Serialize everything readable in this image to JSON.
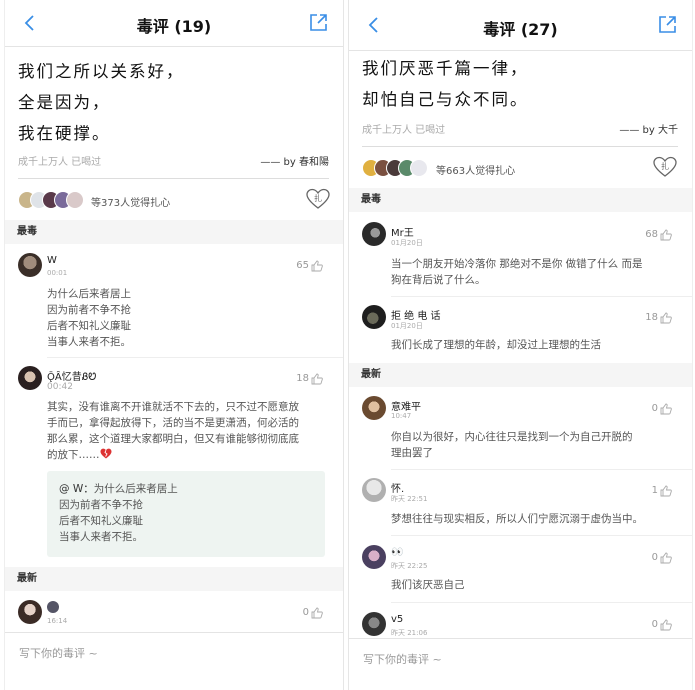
{
  "left": {
    "title": "毒评 (19)",
    "quote_lines": [
      "我们之所以关系好，",
      "全是因为，",
      "我在硬撑。"
    ],
    "tags": "成千上万人  已喝过",
    "author_prefix": "—— by",
    "author": "春和陽",
    "likes_text": "等373人觉得扎心",
    "heart_label": "扎",
    "section_hot": "最毒",
    "comments": [
      {
        "name": "W",
        "time": "00:01",
        "count": "65",
        "lines": [
          "为什么后来者居上",
          "因为前者不争不抢",
          "后者不知礼义廉耻",
          "当事人来者不拒。"
        ]
      },
      {
        "name": "ǬȂ忆昔ᏰᏬ",
        "time": "00:42",
        "count": "18",
        "lines": [
          "其实，没有谁离不开谁就活不下去的，只不过不愿意放",
          "手而已，拿得起放得下，活的当不是更潇洒，何必活的",
          "那么累，这个道理大家都明白，但又有谁能够彻彻底底",
          "那么累，这个道理大家都明白，但又有谁能够彻彻底底"
        ],
        "text_full": [
          "其实，没有谁离不开谁就活不下去的，只不过不愿意放",
          "手而已，拿得起放得下，活的当不是更潇洒，何必活的",
          "那么累，这个道理大家都明白，但又有谁能够彻彻底底",
          "的放下……"
        ]
      }
    ],
    "reply_name": "@ W：",
    "reply_lines": [
      "为什么后来者居上",
      "因为前者不争不抢",
      "后者不知礼义廉耻",
      "当事人来者不拒。"
    ],
    "section_new": "最新",
    "new_comment": {
      "time": "16:14",
      "count": "0"
    },
    "input_placeholder": "写下你的毒评 ~"
  },
  "right": {
    "title": "毒评 (27)",
    "quote_lines": [
      "我们厌恶千篇一律，",
      "却怕自己与众不同。"
    ],
    "tags": "成千上万人  已喝过",
    "author_prefix": "—— by",
    "author": "大千",
    "likes_text": "等663人觉得扎心",
    "heart_label": "扎",
    "section_hot": "最毒",
    "hot": [
      {
        "name": "Mr王",
        "time": "01月20日",
        "count": "68",
        "lines": [
          "当一个朋友开始冷落你 那绝对不是你 做错了什么 而是",
          "狗在背后说了什么。"
        ]
      },
      {
        "name": "拒 绝 电 话",
        "time": "01月20日",
        "count": "18",
        "lines": [
          "我们长成了理想的年龄，却没过上理想的生活"
        ]
      }
    ],
    "section_new": "最新",
    "latest": [
      {
        "name": "意难平",
        "time": "10:47",
        "count": "0",
        "lines": [
          "你自以为很好，内心往往只是找到一个为自己开脱的",
          "理由罢了"
        ]
      },
      {
        "name": "怀.",
        "time": "昨天 22:51",
        "count": "1",
        "lines": [
          "梦想往往与现实相反，所以人们宁愿沉溺于虚伪当中。"
        ]
      },
      {
        "name": "👀",
        "time": "昨天 22:25",
        "count": "0",
        "lines": [
          "我们该厌恶自己"
        ]
      },
      {
        "name": "v5",
        "time": "昨天 21:06",
        "count": "0",
        "lines": []
      }
    ],
    "input_placeholder": "写下你的毒评 ~"
  },
  "colors": {
    "accent": "#3a8ee6",
    "section_bg": "#f5f5f5",
    "reply_bg": "#eef4f1",
    "heart_red": "#d33"
  }
}
